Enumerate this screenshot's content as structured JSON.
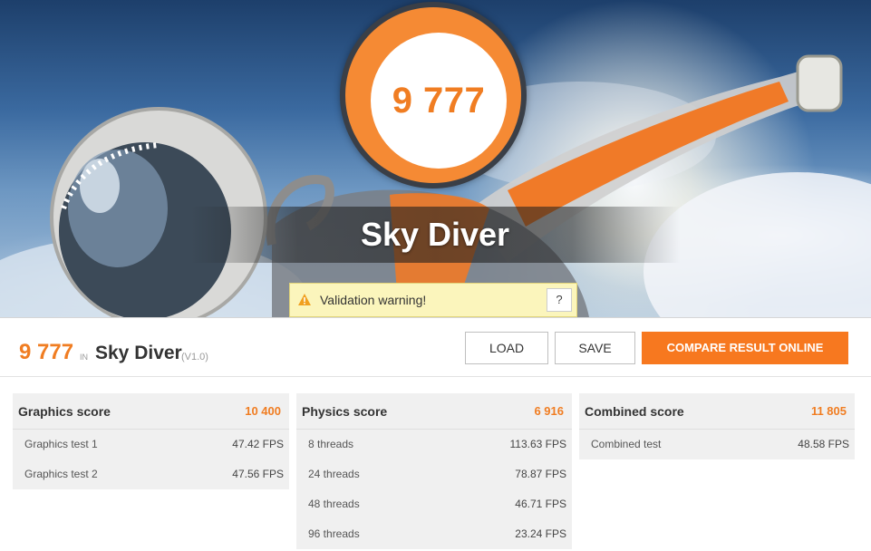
{
  "hero": {
    "score": "9 777",
    "title": "Sky Diver",
    "warning_text": "Validation warning!",
    "help_label": "?"
  },
  "result": {
    "score": "9 777",
    "in_label": "IN",
    "benchmark": "Sky Diver",
    "version": "(V1.0)"
  },
  "buttons": {
    "load": "LOAD",
    "save": "SAVE",
    "compare": "COMPARE RESULT ONLINE"
  },
  "panels": {
    "graphics": {
      "title": "Graphics score",
      "value": "10 400",
      "rows": [
        {
          "label": "Graphics test 1",
          "value": "47.42 FPS"
        },
        {
          "label": "Graphics test 2",
          "value": "47.56 FPS"
        }
      ]
    },
    "physics": {
      "title": "Physics score",
      "value": "6 916",
      "rows": [
        {
          "label": "8 threads",
          "value": "113.63 FPS"
        },
        {
          "label": "24 threads",
          "value": "78.87 FPS"
        },
        {
          "label": "48 threads",
          "value": "46.71 FPS"
        },
        {
          "label": "96 threads",
          "value": "23.24 FPS"
        }
      ]
    },
    "combined": {
      "title": "Combined score",
      "value": "11 805",
      "rows": [
        {
          "label": "Combined test",
          "value": "48.58 FPS"
        }
      ]
    }
  },
  "colors": {
    "accent": "#f07d22",
    "button_primary": "#f7781f",
    "warning_bg": "#fbf5bc"
  },
  "icons": [
    "warning-triangle-icon"
  ]
}
